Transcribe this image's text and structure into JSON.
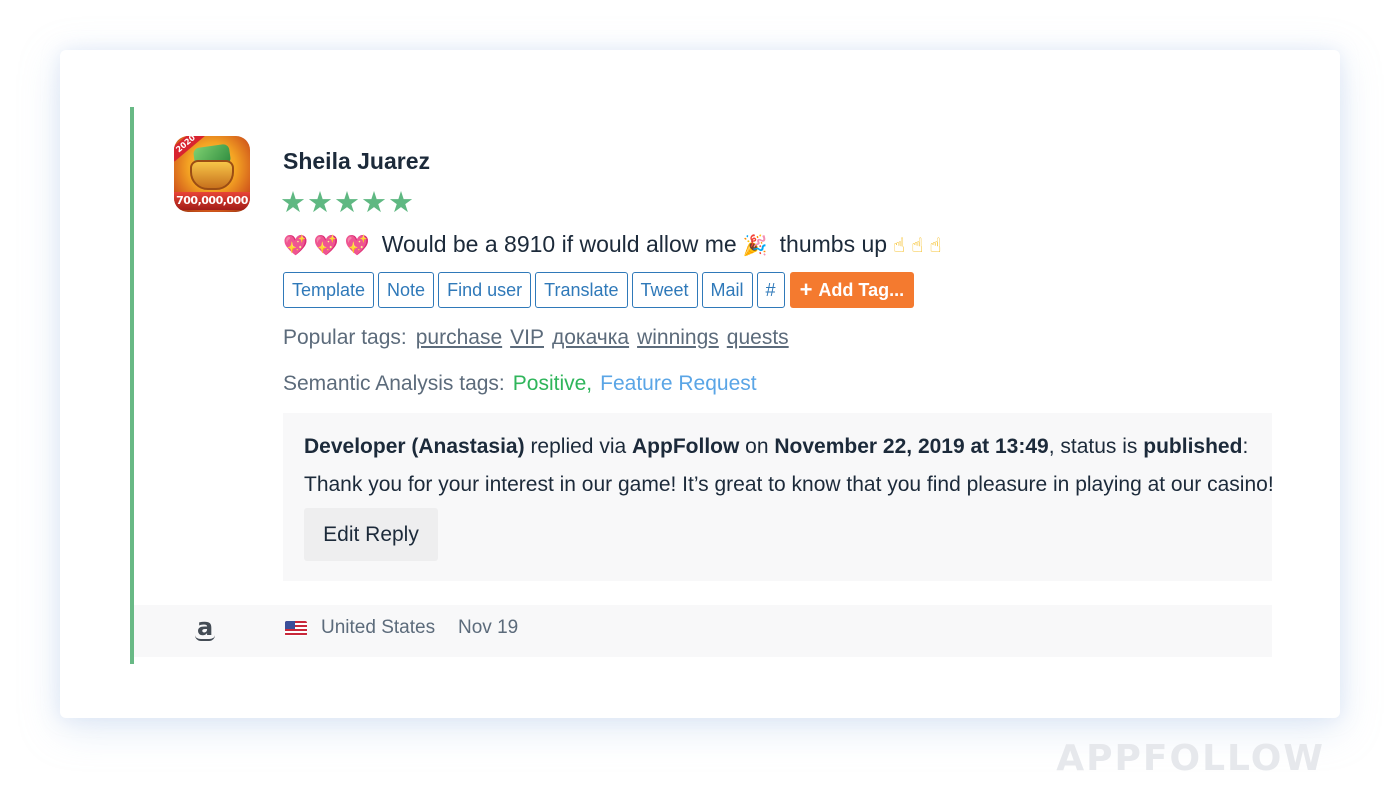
{
  "review": {
    "author": "Sheila Juarez",
    "rating": 5,
    "rating_max": 5,
    "app_icon": {
      "ribbon": "2020",
      "amount": "700,000,000"
    },
    "text_prefix_emojis": [
      "💖",
      "💖",
      "💖"
    ],
    "text": "Would be a 8910 if would allow me",
    "text_mid_emoji": "🎉",
    "text_suffix": "thumbs up",
    "text_suffix_emojis": [
      "☝",
      "☝",
      "☝"
    ],
    "accent_color": "#68b985"
  },
  "actions": {
    "buttons": [
      {
        "label": "Template"
      },
      {
        "label": "Note"
      },
      {
        "label": "Find user"
      },
      {
        "label": "Translate"
      },
      {
        "label": "Tweet"
      },
      {
        "label": "Mail"
      },
      {
        "label": "#"
      }
    ],
    "add_tag_label": "Add Tag...",
    "add_tag_icon": "+",
    "button_color": "#2f79b9",
    "add_tag_color": "#f47a2f"
  },
  "popular_tags": {
    "label": "Popular tags:",
    "tags": [
      "purchase",
      "VIP",
      "докачка",
      "winnings",
      "quests"
    ]
  },
  "semantic_tags": {
    "label": "Semantic Analysis tags:",
    "positive": "Positive,",
    "feature": "Feature Request",
    "positive_color": "#2fb55b",
    "feature_color": "#5aa5e6"
  },
  "reply": {
    "developer": "Developer (Anastasia)",
    "via_text": "replied via",
    "platform": "AppFollow",
    "on_text": "on",
    "datetime": "November 22, 2019 at 13:49",
    "status_text": ", status is",
    "status": "published",
    "colon": ":",
    "body": "Thank you for your interest in our game! It’s great to know that you find pleasure in playing at our casino!",
    "edit_label": "Edit Reply"
  },
  "footer": {
    "store_icon": "a",
    "country": "United States",
    "date": "Nov 19"
  },
  "watermark": "APPFOLLOW"
}
